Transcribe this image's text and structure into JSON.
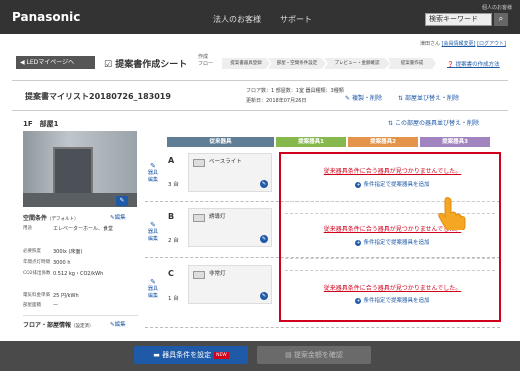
{
  "header": {
    "logo": "Panasonic",
    "nav": [
      "法人のお客様",
      "サポート"
    ],
    "personal": "個人のお客様",
    "search_placeholder": "検索キーワード",
    "search_icon": "search-icon"
  },
  "user": {
    "name": "津田さん",
    "link1": "[会員情報変更]",
    "link2": "[ログアウト]"
  },
  "toolbar": {
    "back": "◀ LEDマイページへ",
    "title": "提案書作成シート",
    "flow_label": "作成\nフロー",
    "steps": [
      "提案書器具登録",
      "部屋・空間条件設定",
      "プレビュー・金額確認",
      "提案書作成"
    ],
    "flow_link": "提案書の作成方法"
  },
  "list": {
    "name": "提案書マイリスト20180726_183019",
    "floor_info": "フロア数：1 部屋数：1室 器具種類：3種類",
    "updated": "更新日：2018年07月26日",
    "action_copy": "複製・削除",
    "action_sort": "部屋並び替え・削除"
  },
  "room": {
    "floor_label": "1F　部屋1",
    "sort_link": "この部屋の器具並び替え・削除",
    "edit": "編集"
  },
  "space": {
    "title": "空間条件",
    "title_note": "（デフォルト）",
    "edit": "編集",
    "rows": [
      {
        "k": "用途",
        "v": "エレベーターホール、食堂"
      },
      {
        "k": "必要照度",
        "v": "300lx (床面)"
      },
      {
        "k": "年間点灯時間",
        "v": "3000 h"
      },
      {
        "k": "CO2排出係数",
        "v": "0.512 kg・CO2/kWh"
      },
      {
        "k": "電気料金単価",
        "v": "25 円/kWh"
      },
      {
        "k": "部屋面積",
        "v": "ー"
      }
    ]
  },
  "floor_section": {
    "title": "フロア・部屋情報",
    "title_note": "（設定済）",
    "edit": "編集"
  },
  "tabs": [
    "従来器具",
    "提案器具1",
    "提案器具2",
    "提案器具3"
  ],
  "fixtures": [
    {
      "letter": "A",
      "count": "3 台",
      "name": "ベースライト",
      "edit": "器具\n編集"
    },
    {
      "letter": "B",
      "count": "2 台",
      "name": "誘導灯",
      "edit": "器具\n編集"
    },
    {
      "letter": "C",
      "count": "1 台",
      "name": "非常灯",
      "edit": "器具\n編集"
    }
  ],
  "proposal": {
    "not_found": "従来器具条件に合う器具が見つかりませんでした。",
    "add": "条件指定で提案器具を追加"
  },
  "footer": {
    "set_conditions": "器具条件を設定",
    "new_badge": "NEW",
    "check_price": "提案金額を確認"
  },
  "colors": {
    "accent": "#1e5aa8",
    "alert": "#d0021b",
    "tab_existing": "#5f7e96",
    "tab_p1": "#87b84e",
    "tab_p2": "#e3934a",
    "tab_p3": "#a183c0"
  }
}
